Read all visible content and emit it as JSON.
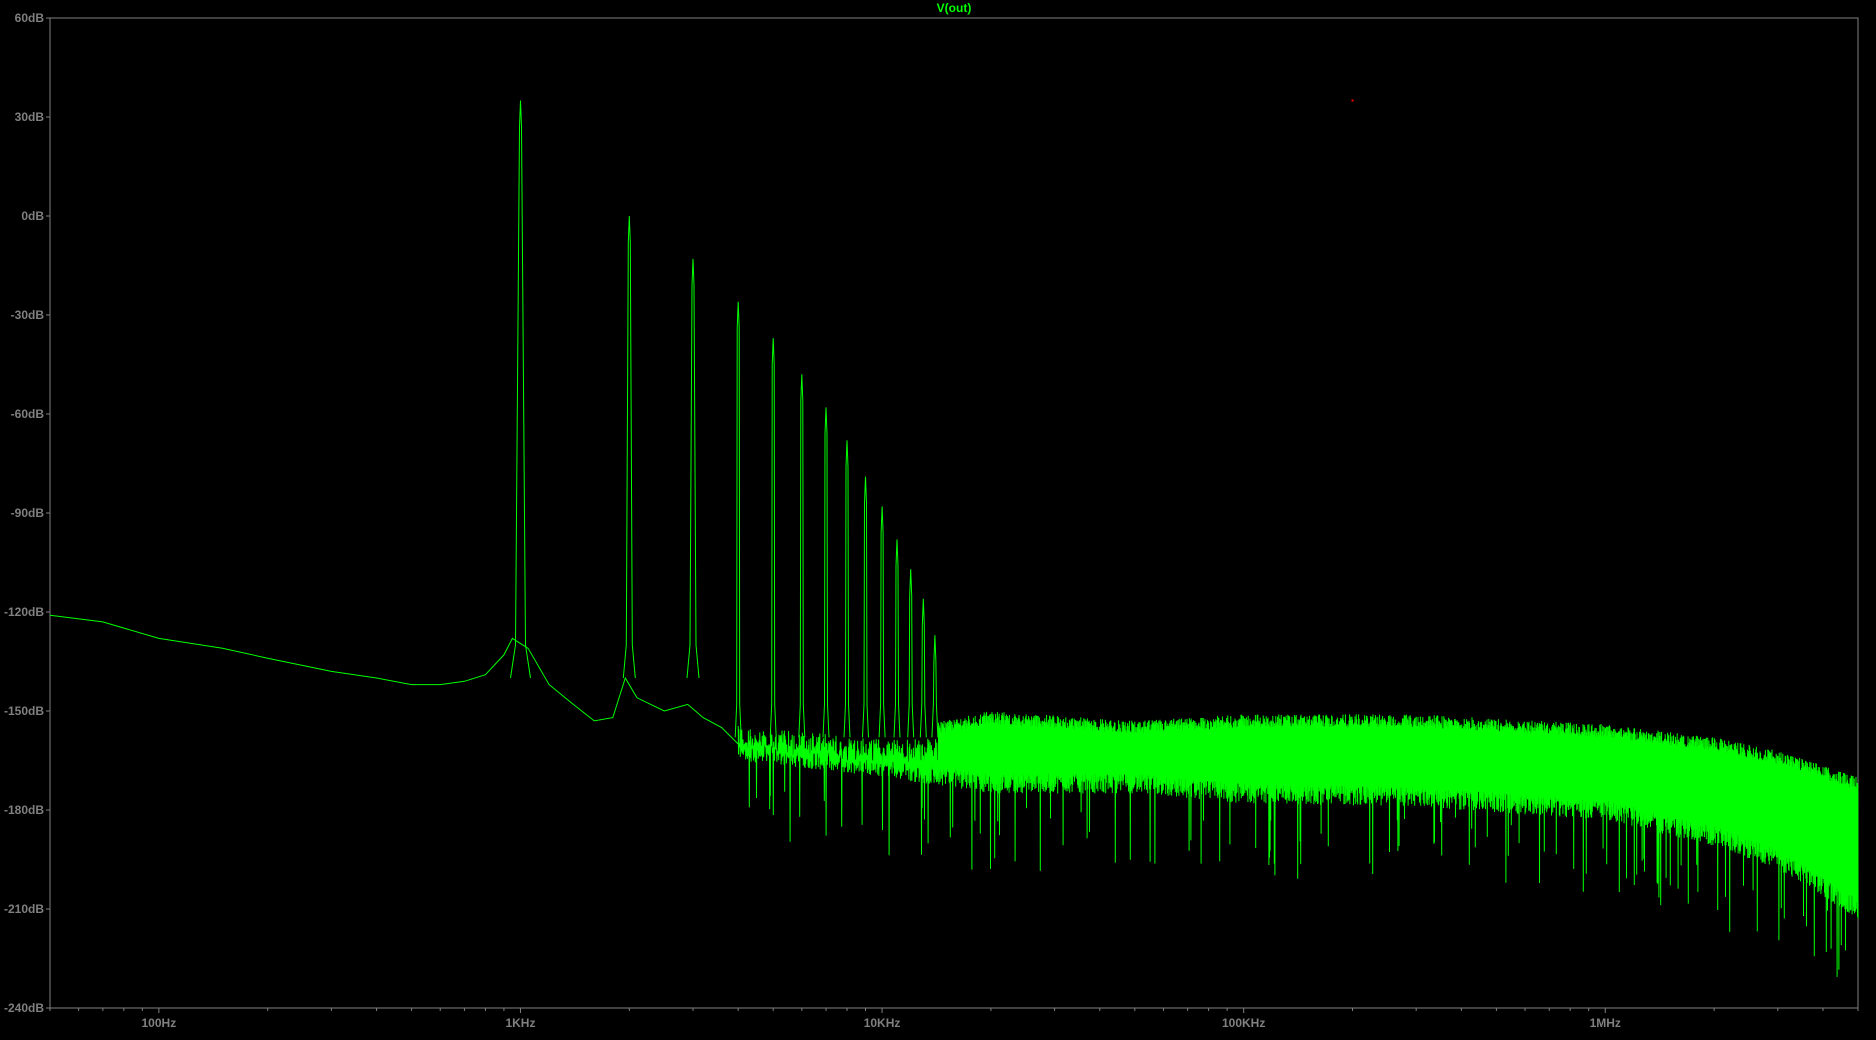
{
  "window": {
    "background": "#000000",
    "frame_color": "#808080"
  },
  "chart_data": {
    "type": "line",
    "title": "V(out)",
    "title_color": "#00FF00",
    "trace_color": "#00FF00",
    "label_color": "#808080",
    "xscale": "log",
    "xlim_hz": [
      50,
      5000000
    ],
    "ylim_db": [
      -240,
      60
    ],
    "grid": false,
    "y_ticks": [
      {
        "value": 60,
        "label": "60dB"
      },
      {
        "value": 30,
        "label": "30dB"
      },
      {
        "value": 0,
        "label": "0dB"
      },
      {
        "value": -30,
        "label": "-30dB"
      },
      {
        "value": -60,
        "label": "-60dB"
      },
      {
        "value": -90,
        "label": "-90dB"
      },
      {
        "value": -120,
        "label": "-120dB"
      },
      {
        "value": -150,
        "label": "-150dB"
      },
      {
        "value": -180,
        "label": "-180dB"
      },
      {
        "value": -210,
        "label": "-210dB"
      },
      {
        "value": -240,
        "label": "-240dB"
      }
    ],
    "x_ticks": [
      {
        "value": 100,
        "label": "100Hz"
      },
      {
        "value": 1000,
        "label": "1KHz"
      },
      {
        "value": 10000,
        "label": "10KHz"
      },
      {
        "value": 100000,
        "label": "100KHz"
      },
      {
        "value": 1000000,
        "label": "1MHz"
      }
    ],
    "baseline": [
      [
        50,
        -121
      ],
      [
        70,
        -123
      ],
      [
        100,
        -128
      ],
      [
        150,
        -131
      ],
      [
        200,
        -134
      ],
      [
        300,
        -138
      ],
      [
        400,
        -140
      ],
      [
        500,
        -142
      ],
      [
        600,
        -142
      ],
      [
        700,
        -141
      ],
      [
        800,
        -139
      ],
      [
        900,
        -133
      ],
      [
        950,
        -128
      ],
      [
        1050,
        -131
      ],
      [
        1200,
        -142
      ],
      [
        1400,
        -148
      ],
      [
        1600,
        -153
      ],
      [
        1800,
        -152
      ],
      [
        1950,
        -140
      ],
      [
        2100,
        -146
      ],
      [
        2500,
        -150
      ],
      [
        2900,
        -148
      ],
      [
        3200,
        -152
      ],
      [
        3600,
        -155
      ],
      [
        4000,
        -160
      ],
      [
        5000,
        -158
      ],
      [
        7000,
        -160
      ],
      [
        10000,
        -163
      ],
      [
        20000,
        -165
      ],
      [
        50000,
        -164
      ],
      [
        100000,
        -163
      ],
      [
        200000,
        -162
      ],
      [
        500000,
        -161
      ],
      [
        1000000,
        -163
      ],
      [
        2000000,
        -166
      ],
      [
        3000000,
        -170
      ],
      [
        5000000,
        -185
      ]
    ],
    "noise_envelope": [
      {
        "f": 4000,
        "top": -155,
        "bottom": -162
      },
      {
        "f": 10000,
        "top": -158,
        "bottom": -167
      },
      {
        "f": 20000,
        "top": -152,
        "bottom": -172
      },
      {
        "f": 50000,
        "top": -155,
        "bottom": -172
      },
      {
        "f": 100000,
        "top": -153,
        "bottom": -175
      },
      {
        "f": 300000,
        "top": -153,
        "bottom": -176
      },
      {
        "f": 1000000,
        "top": -156,
        "bottom": -180
      },
      {
        "f": 2000000,
        "top": -160,
        "bottom": -188
      },
      {
        "f": 3000000,
        "top": -164,
        "bottom": -195
      },
      {
        "f": 5000000,
        "top": -172,
        "bottom": -210
      }
    ],
    "harmonics": [
      {
        "f": 1000,
        "db": 35
      },
      {
        "f": 2000,
        "db": 0
      },
      {
        "f": 3000,
        "db": -13
      },
      {
        "f": 4000,
        "db": -26
      },
      {
        "f": 5000,
        "db": -37
      },
      {
        "f": 6000,
        "db": -48
      },
      {
        "f": 7000,
        "db": -58
      },
      {
        "f": 8000,
        "db": -68
      },
      {
        "f": 9000,
        "db": -79
      },
      {
        "f": 10000,
        "db": -88
      },
      {
        "f": 11000,
        "db": -98
      },
      {
        "f": 12000,
        "db": -107
      },
      {
        "f": 13000,
        "db": -116
      },
      {
        "f": 14000,
        "db": -127
      }
    ],
    "marker_point": {
      "f": 200000,
      "db": 35,
      "color": "#FF0000"
    }
  }
}
